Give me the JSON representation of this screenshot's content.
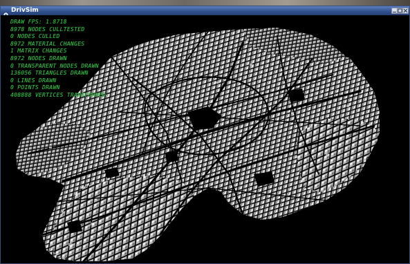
{
  "window": {
    "title": "DrivSim",
    "colors": {
      "titlebar": "#32528f",
      "viewport_bg": "#000000",
      "stats_text": "#35c94a"
    },
    "icons": [
      "app-icon",
      "minimize-icon",
      "maximize-icon",
      "close-icon"
    ]
  },
  "stats": [
    "DRAW FPS: 1.8718",
    "8978 NODES CULLTESTED",
    "0 NODES CULLED",
    "8972 MATERIAL CHANGES",
    "1 MATRIX CHANGES",
    "8972 NODES DRAWN",
    "0 TRANSPARENT NODES DRAWN",
    "136056 TRIANGLES DRAWN",
    "0 LINES DRAWN",
    "0 POINTS DRAWN",
    "408888 VERTICES TRANSFORMED"
  ]
}
